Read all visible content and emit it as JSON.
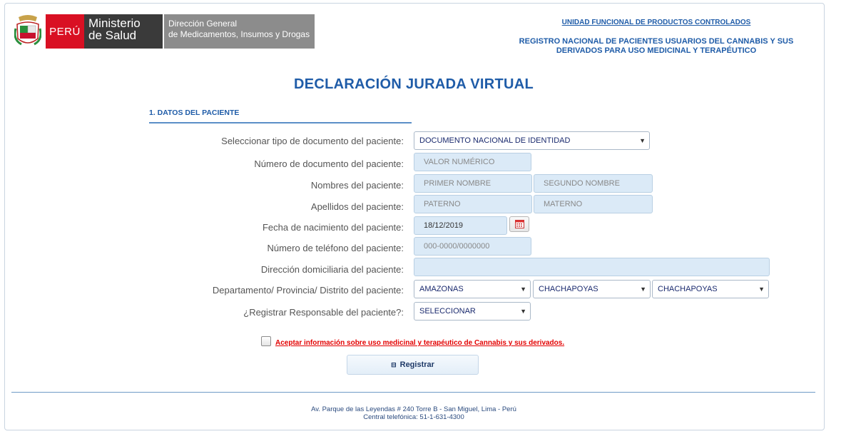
{
  "header": {
    "country": "PERÚ",
    "ministry_line1": "Ministerio",
    "ministry_line2": "de Salud",
    "directorate_line1": "Dirección General",
    "directorate_line2": "de Medicamentos, Insumos y Drogas",
    "unit_link": "UNIDAD FUNCIONAL DE PRODUCTOS CONTROLADOS",
    "registry_line1": "REGISTRO NACIONAL DE PACIENTES USUARIOS DEL CANNABIS Y SUS",
    "registry_line2": "DERIVADOS PARA USO MEDICINAL Y TERAPÉUTICO"
  },
  "title": "DECLARACIÓN JURADA VIRTUAL",
  "section": "1. DATOS DEL PACIENTE",
  "form": {
    "doc_type": {
      "label": "Seleccionar tipo de documento del paciente:",
      "value": "DOCUMENTO NACIONAL DE IDENTIDAD"
    },
    "doc_number": {
      "label": "Número de documento del paciente:",
      "placeholder": "VALOR NUMÉRICO"
    },
    "names": {
      "label": "Nombres del paciente:",
      "first_placeholder": "PRIMER NOMBRE",
      "second_placeholder": "SEGUNDO NOMBRE"
    },
    "surnames": {
      "label": "Apellidos del paciente:",
      "paternal_placeholder": "PATERNO",
      "maternal_placeholder": "MATERNO"
    },
    "birth_date": {
      "label": "Fecha de nacimiento del paciente:",
      "value": "18/12/2019"
    },
    "phone": {
      "label": "Número de teléfono del paciente:",
      "placeholder": "000-0000/0000000"
    },
    "address": {
      "label": "Dirección domiciliaria del paciente:",
      "placeholder": ""
    },
    "location": {
      "label": "Departamento/ Provincia/ Distrito del paciente:",
      "department": "AMAZONAS",
      "province": "CHACHAPOYAS",
      "district": "CHACHAPOYAS"
    },
    "responsible": {
      "label": "¿Registrar Responsable del paciente?:",
      "value": "SELECCIONAR"
    }
  },
  "accept_text": "Aceptar información sobre uso medicinal y terapéutico de Cannabis y sus derivados.",
  "register_label": "Registrar",
  "footer": {
    "address": "Av. Parque de las Leyendas # 240 Torre B - San Miguel, Lima - Perú",
    "phone": "Central telefónica: 51-1-631-4300"
  },
  "colors": {
    "primary": "#1f5ca8",
    "peru_red": "#d91023",
    "field_bg": "#dbeaf7",
    "link_red": "#e30000"
  }
}
